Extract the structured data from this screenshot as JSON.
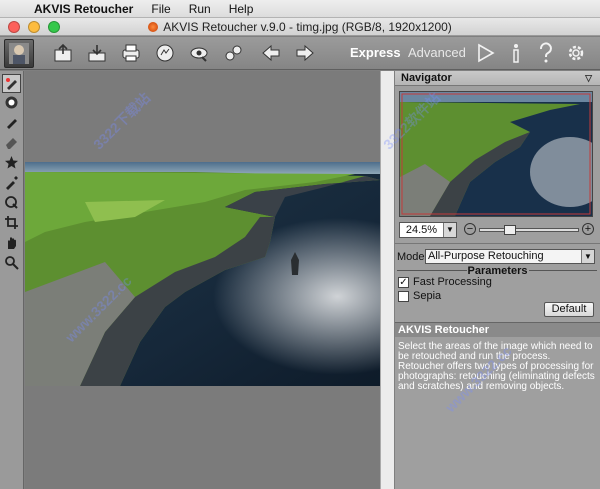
{
  "menubar": {
    "app_name": "AKVIS Retoucher",
    "items": [
      "File",
      "Run",
      "Help"
    ]
  },
  "window": {
    "title": "AKVIS Retoucher v.9.0 - timg.jpg (RGB/8, 1920x1200)"
  },
  "toolbar": {
    "modes": {
      "express": "Express",
      "advanced": "Advanced"
    },
    "icons": [
      "open-icon",
      "save-icon",
      "print-icon",
      "share-icon",
      "batch-icon",
      "settings-preset-icon",
      "back-arrow-icon",
      "forward-arrow-icon",
      "run-icon",
      "info-icon",
      "help-icon",
      "preferences-icon"
    ]
  },
  "tools": [
    "retouch-brush-icon",
    "patch-icon",
    "clone-icon",
    "eraser-icon",
    "star-icon",
    "dropper-icon",
    "chameleon-icon",
    "crop-icon",
    "hand-icon",
    "zoom-icon"
  ],
  "navigator": {
    "title": "Navigator",
    "zoom": "24.5%",
    "zoom_slider_fraction": 0.28
  },
  "settings": {
    "mode_label": "Mode:",
    "mode_value": "All-Purpose Retouching",
    "parameters_title": "Parameters",
    "fast_processing": {
      "label": "Fast Processing",
      "checked": true
    },
    "sepia": {
      "label": "Sepia",
      "checked": false
    },
    "default_button": "Default"
  },
  "help": {
    "title": "AKVIS Retoucher",
    "text": "Select the areas of the image which need to be retouched and run the process. Retoucher offers two types of processing for photographs: retouching (eliminating defects and scratches) and removing objects."
  },
  "colors": {
    "toolbar": "#8f8f8f",
    "panel": "#9f9f9f",
    "canvas": "#7b7b7b"
  }
}
